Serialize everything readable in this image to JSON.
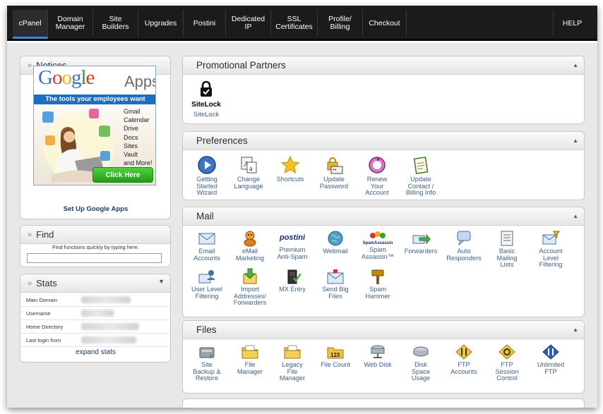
{
  "nav": {
    "items": [
      "cPanel",
      "Domain\nManager",
      "Site\nBuilders",
      "Upgrades",
      "Postini",
      "Dedicated\nIP",
      "SSL\nCertificates",
      "Profile/\nBilling",
      "Checkout"
    ],
    "help": "HELP",
    "active_index": 0
  },
  "notices": {
    "title": "Notices",
    "ad": {
      "logo_letters": [
        "G",
        "o",
        "o",
        "g",
        "l",
        "e"
      ],
      "logo_colors": [
        "#3a6fd6",
        "#d23b2b",
        "#f0b400",
        "#3a6fd6",
        "#2f9a3a",
        "#d23b2b"
      ],
      "apps": "Apps",
      "tagline": "The tools your employees want",
      "features": [
        "Gmail",
        "Calendar",
        "Drive",
        "Docs",
        "Sites",
        "Vault",
        "and More!"
      ],
      "cta": "Click Here"
    },
    "setup_link": "Set Up Google Apps"
  },
  "find": {
    "title": "Find",
    "hint": "Find functions quickly by typing here.",
    "input_value": ""
  },
  "stats": {
    "title": "Stats",
    "rows": [
      "Main Domain",
      "Username",
      "Home Directory",
      "Last login from"
    ],
    "expand": "expand stats"
  },
  "sections": {
    "promotional": {
      "title": "Promotional Partners",
      "sitelock_logo": "SiteLock",
      "sitelock_label": "SiteLock"
    },
    "preferences": {
      "title": "Preferences",
      "items": [
        "Getting\nStarted\nWizard",
        "Change\nLanguage",
        "Shortcuts",
        "Update\nPassword",
        "Renew\nYour\nAccount",
        "Update\nContact /\nBilling Info"
      ]
    },
    "mail": {
      "title": "Mail",
      "postini_logo": "postini",
      "spamassassin_logo": "SpamAssassin",
      "items": [
        "Email\nAccounts",
        "eMail\nMarketing",
        "Premium\nAnti-Spam",
        "Webmail",
        "Spam\nAssassin™",
        "Forwarders",
        "Auto\nResponders",
        "Basic\nMailing\nLists",
        "Account\nLevel\nFiltering",
        "User Level\nFiltering",
        "Import\nAddresses/\nForwarders",
        "MX Entry",
        "Send Big\nFiles",
        "Spam\nHammer"
      ]
    },
    "files": {
      "title": "Files",
      "items": [
        "Site\nBackup &\nRestore",
        "File\nManager",
        "Legacy\nFile\nManager",
        "File Count",
        "Web Disk",
        "Disk\nSpace\nUsage",
        "FTP\nAccounts",
        "FTP\nSession\nControl",
        "Unlimited\nFTP"
      ]
    }
  },
  "colors": {
    "nav_bg": "#1b1b1b",
    "active_underline": "#2f8ddb",
    "link": "#3d5f86",
    "panel_bg": "#e8e8e8"
  }
}
